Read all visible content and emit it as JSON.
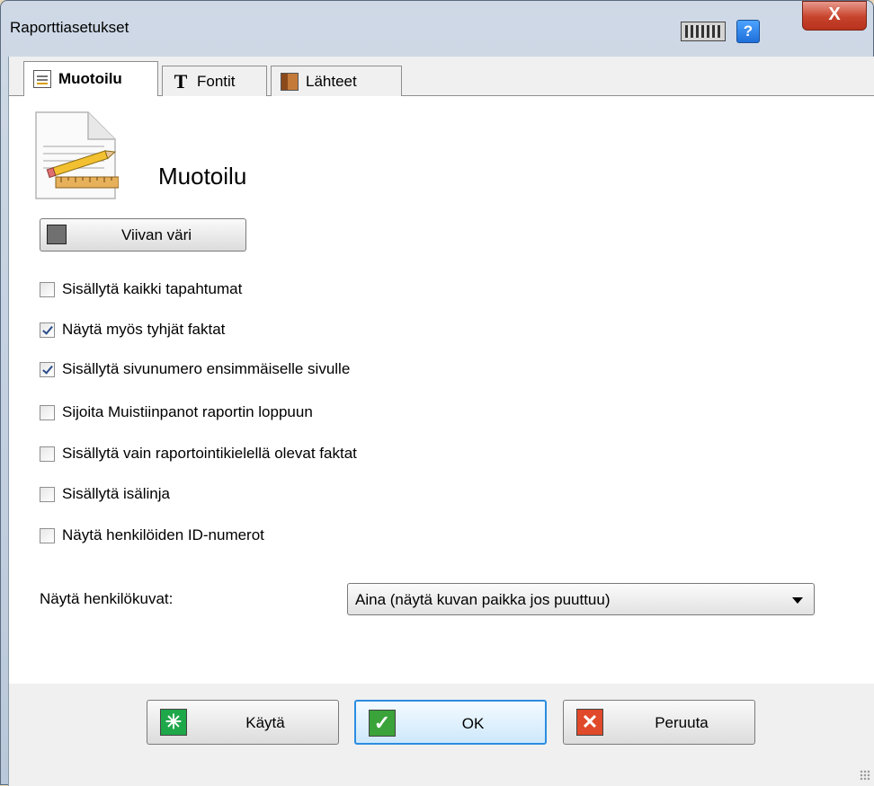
{
  "window": {
    "title": "Raporttiasetukset",
    "help_label": "?",
    "close_label": "X"
  },
  "tabs": [
    {
      "label": "Muotoilu",
      "active": true,
      "icon": "format-icon"
    },
    {
      "label": "Fontit",
      "active": false,
      "icon": "font-icon"
    },
    {
      "label": "Lähteet",
      "active": false,
      "icon": "sources-icon"
    }
  ],
  "page": {
    "section_title": "Muotoilu",
    "line_color_button": "Viivan väri",
    "line_color": "#707070",
    "checkboxes": [
      {
        "label": "Sisällytä kaikki tapahtumat",
        "checked": false
      },
      {
        "label": "Näytä myös tyhjät faktat",
        "checked": true
      },
      {
        "label": "Sisällytä sivunumero ensimmäiselle sivulle",
        "checked": true
      },
      {
        "label": "Sijoita Muistiinpanot raportin loppuun",
        "checked": false
      },
      {
        "label": "Sisällytä vain raportointikielellä olevat faktat",
        "checked": false
      },
      {
        "label": "Sisällytä isälinja",
        "checked": false
      },
      {
        "label": "Näytä henkilöiden ID-numerot",
        "checked": false
      }
    ],
    "photos_label": "Näytä henkilökuvat:",
    "photos_value": "Aina (näytä kuvan paikka jos puuttuu)"
  },
  "buttons": {
    "apply": "Käytä",
    "ok": "OK",
    "cancel": "Peruuta"
  },
  "colors": {
    "accent": "#2a8de0",
    "apply_icon": "#1ea84a",
    "ok_icon": "#3aa33a",
    "cancel_icon": "#e04a2a"
  }
}
